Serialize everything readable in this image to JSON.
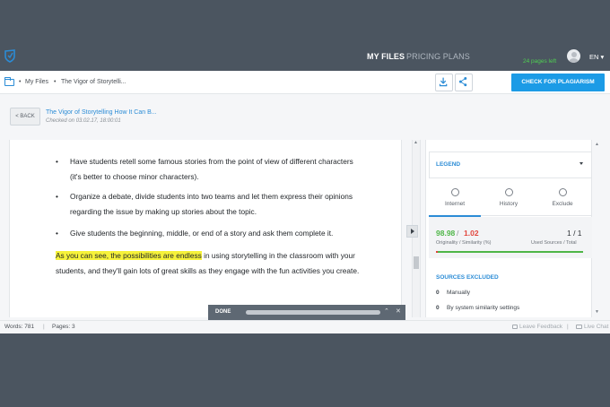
{
  "header": {
    "nav_my_files": "MY FILES",
    "nav_pricing": "PRICING PLANS",
    "pages_left": "24 pages left",
    "language": "EN ▾"
  },
  "toolbar": {
    "breadcrumb_sep": "•",
    "crumb_my_files": "My Files",
    "crumb_doc": "The Vigor of Storytelli...",
    "check_button": "CHECK FOR PLAGIARISM"
  },
  "doc_header": {
    "back": "< BACK",
    "title": "The Vigor of Storytelling How It Can B...",
    "checked": "Checked on 03.02.17, 18:00:01"
  },
  "document": {
    "bullet": "•",
    "bullets": [
      "Have students retell some famous stories from the point of view of different characters (it's better to choose minor characters).",
      "Organize a debate, divide students into two teams and let them express their opinions regarding the issue by making up stories about the topic.",
      "Give students the beginning, middle, or end of a story and ask them complete it."
    ],
    "para_highlight": "As you can see, the possibilities are endless",
    "para_rest": " in using storytelling in the classroom with your students, and they'll gain lots of great skills as they engage with the fun activities you create."
  },
  "done_bar": {
    "label": "DONE",
    "chevron": "⌃",
    "close": "✕"
  },
  "right_panel": {
    "legend": "LEGEND",
    "tabs": [
      {
        "label": "Internet",
        "icon": "globe-icon"
      },
      {
        "label": "History",
        "icon": "clock-icon"
      },
      {
        "label": "Exclude",
        "icon": "exclude-icon"
      }
    ],
    "originality": "98.98",
    "slash": "/",
    "similarity": "1.02",
    "score_caption": "Originality / Similarity (%)",
    "sources": "1 / 1",
    "sources_caption": "Used Sources / Total",
    "excluded_title": "SOURCES EXCLUDED",
    "excluded": [
      {
        "count": "0",
        "label": "Manually"
      },
      {
        "count": "0",
        "label": "By system similarity settings"
      }
    ]
  },
  "statusbar": {
    "words": "Words: 781",
    "sep": "|",
    "pages": "Pages: 3",
    "feedback": "Leave Feedback",
    "chat": "Live Chat"
  },
  "colors": {
    "accent": "#1c9be6",
    "originality": "#4fb648",
    "similarity": "#e2453c",
    "highlight": "#f6f23a",
    "dark_bg": "#4b5560"
  }
}
